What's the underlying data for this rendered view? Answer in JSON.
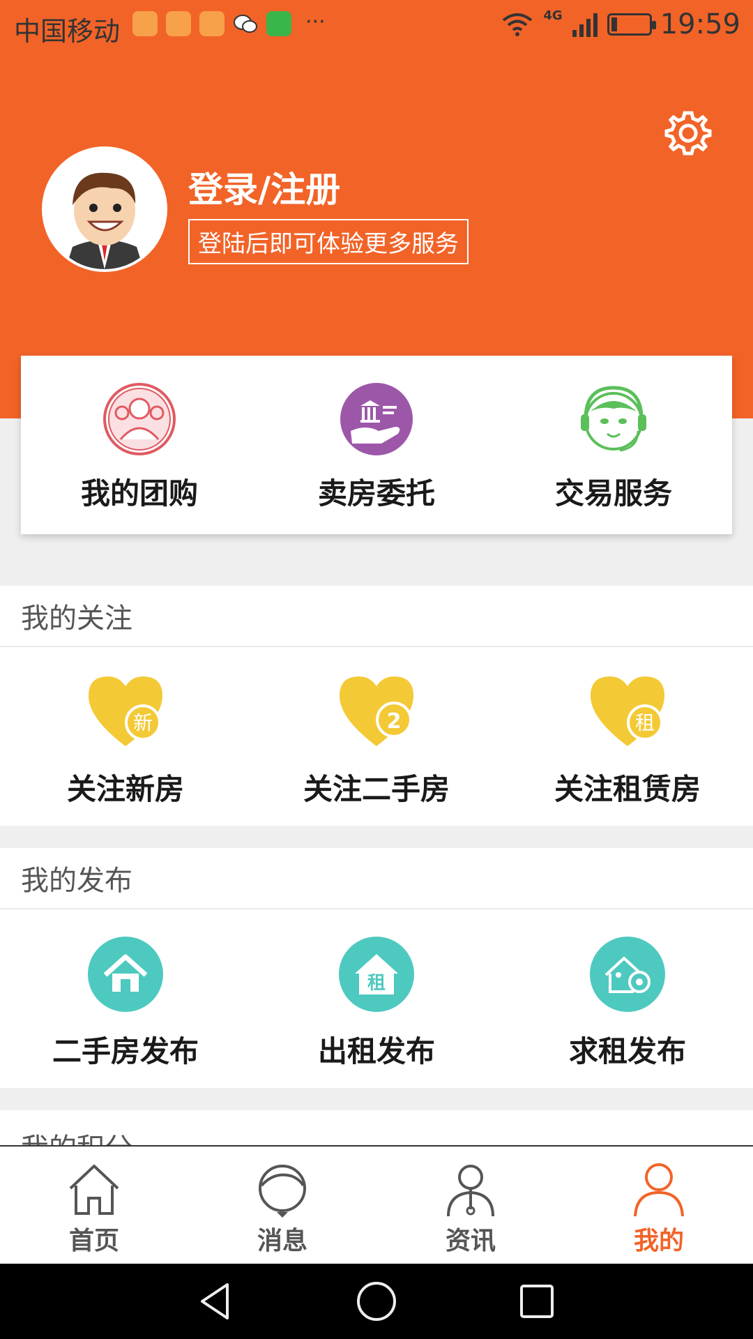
{
  "status_bar": {
    "carrier": "中国移动",
    "network": "4G",
    "time": "19:59",
    "more": "···"
  },
  "header": {
    "login_title": "登录/注册",
    "login_subtitle": "登陆后即可体验更多服务"
  },
  "services": {
    "items": [
      {
        "label": "我的团购",
        "icon": "group-buy-icon",
        "color": "#e05a62"
      },
      {
        "label": "卖房委托",
        "icon": "sell-house-icon",
        "color": "#9c57a8"
      },
      {
        "label": "交易服务",
        "icon": "customer-service-icon",
        "color": "#5bbf5a"
      }
    ]
  },
  "follow": {
    "title": "我的关注",
    "items": [
      {
        "label": "关注新房",
        "icon": "heart-new-icon",
        "badge": "新"
      },
      {
        "label": "关注二手房",
        "icon": "heart-secondhand-icon",
        "badge": "2"
      },
      {
        "label": "关注租赁房",
        "icon": "heart-rent-icon",
        "badge": "租"
      }
    ],
    "color": "#f3c935"
  },
  "publish": {
    "title": "我的发布",
    "items": [
      {
        "label": "二手房发布",
        "icon": "house-publish-icon"
      },
      {
        "label": "出租发布",
        "icon": "rent-publish-icon",
        "badge": "租"
      },
      {
        "label": "求租发布",
        "icon": "seek-rent-icon"
      }
    ],
    "color": "#4ec9c0"
  },
  "points": {
    "title": "我的积分"
  },
  "bottom_nav": {
    "items": [
      {
        "label": "首页",
        "icon": "home-icon"
      },
      {
        "label": "消息",
        "icon": "message-icon"
      },
      {
        "label": "资讯",
        "icon": "news-icon"
      },
      {
        "label": "我的",
        "icon": "profile-icon",
        "active": true
      }
    ],
    "active_color": "#f26328"
  },
  "theme": {
    "primary": "#f26328"
  }
}
